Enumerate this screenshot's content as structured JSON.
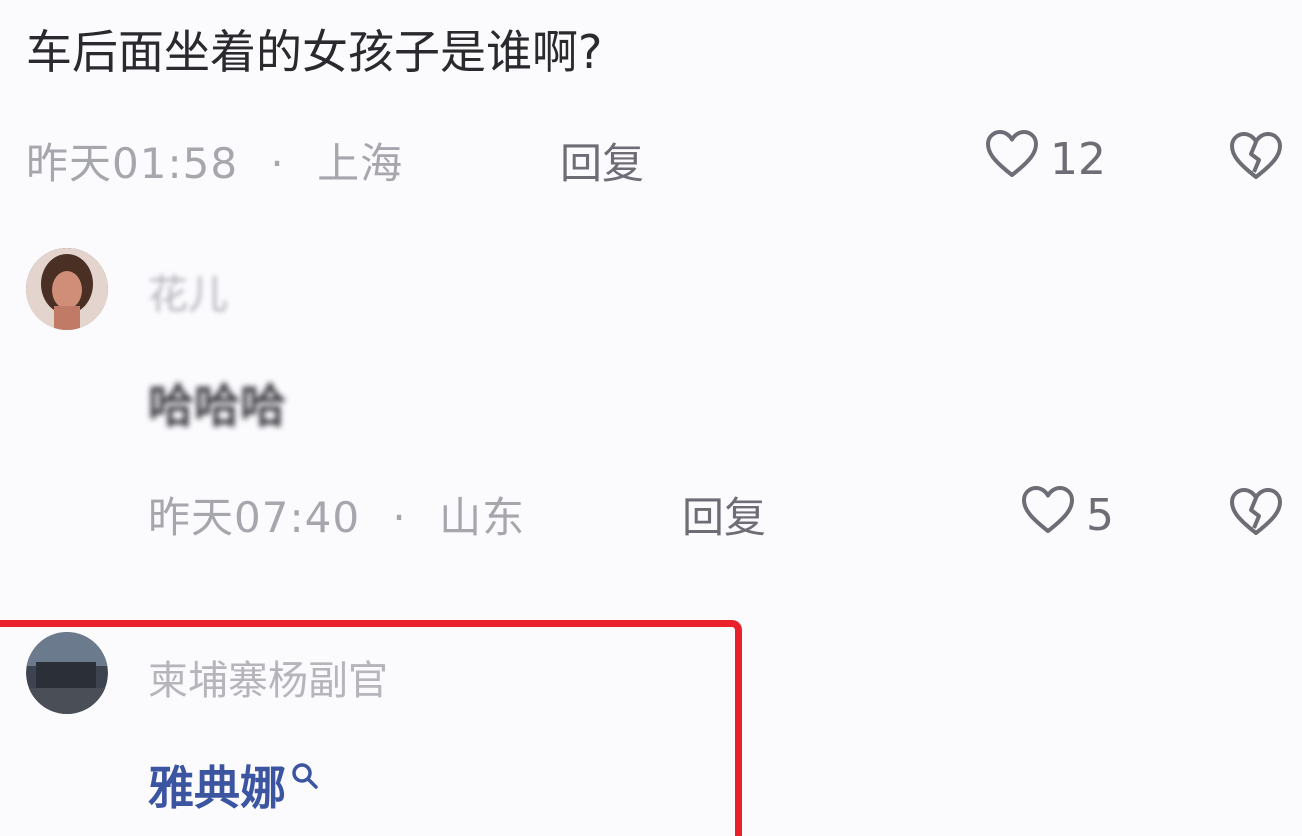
{
  "comments": [
    {
      "text": "车后面坐着的女孩子是谁啊?",
      "time": "昨天01:58",
      "separator": "·",
      "location": "上海",
      "reply_label": "回复",
      "likes": "12",
      "like_icon": "heart-outline-icon",
      "dislike_icon": "broken-heart-icon"
    },
    {
      "username": "花儿",
      "text": "哈哈哈",
      "time": "昨天07:40",
      "separator": "·",
      "location": "山东",
      "reply_label": "回复",
      "likes": "5",
      "like_icon": "heart-outline-icon",
      "dislike_icon": "broken-heart-icon"
    },
    {
      "username": "柬埔寨杨副官",
      "link_text": "雅典娜",
      "link_icon": "search-icon"
    }
  ],
  "highlight_color": "#e8212b",
  "link_color": "#3b55a0"
}
